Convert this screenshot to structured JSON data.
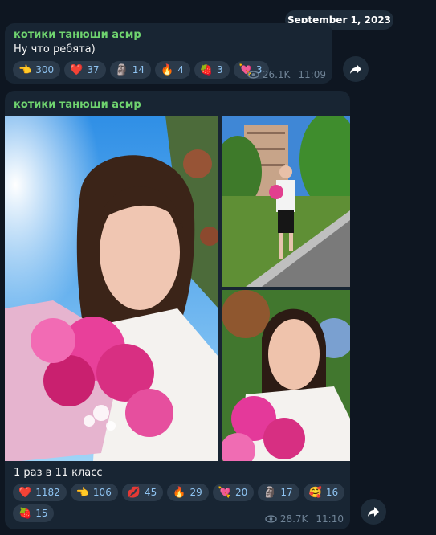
{
  "date_separator": "September 1, 2023",
  "messages": [
    {
      "sender": "котики танюши асмр",
      "text": "Ну что ребята)",
      "reactions": [
        {
          "emoji": "👈",
          "count": "300",
          "icon": "pointing-hand-icon"
        },
        {
          "emoji": "❤️",
          "count": "37",
          "icon": "heart-icon"
        },
        {
          "emoji": "🗿",
          "count": "14",
          "icon": "moai-icon"
        },
        {
          "emoji": "🔥",
          "count": "4",
          "icon": "fire-icon"
        },
        {
          "emoji": "🍓",
          "count": "3",
          "icon": "strawberry-icon"
        },
        {
          "emoji": "💘",
          "count": "3",
          "icon": "heart-arrow-icon"
        }
      ],
      "views": "26.1K",
      "time": "11:09"
    },
    {
      "sender": "котики танюши асмр",
      "text": "1 раз в 11 класс",
      "reactions": [
        {
          "emoji": "❤️",
          "count": "1182",
          "icon": "heart-icon"
        },
        {
          "emoji": "👈",
          "count": "106",
          "icon": "pointing-hand-icon"
        },
        {
          "emoji": "💋",
          "count": "45",
          "icon": "kiss-icon"
        },
        {
          "emoji": "🔥",
          "count": "29",
          "icon": "fire-icon"
        },
        {
          "emoji": "💘",
          "count": "20",
          "icon": "heart-arrow-icon"
        },
        {
          "emoji": "🗿",
          "count": "17",
          "icon": "moai-icon"
        },
        {
          "emoji": "🥰",
          "count": "16",
          "icon": "smiling-hearts-icon"
        },
        {
          "emoji": "🍓",
          "count": "15",
          "icon": "strawberry-icon"
        }
      ],
      "views": "28.7K",
      "time": "11:10"
    }
  ],
  "colors": {
    "background": "#0e1621",
    "bubble": "#182533",
    "sender": "#6fd36f",
    "reaction_bg": "#2b3a4a",
    "reaction_text": "#8fc4f2"
  }
}
